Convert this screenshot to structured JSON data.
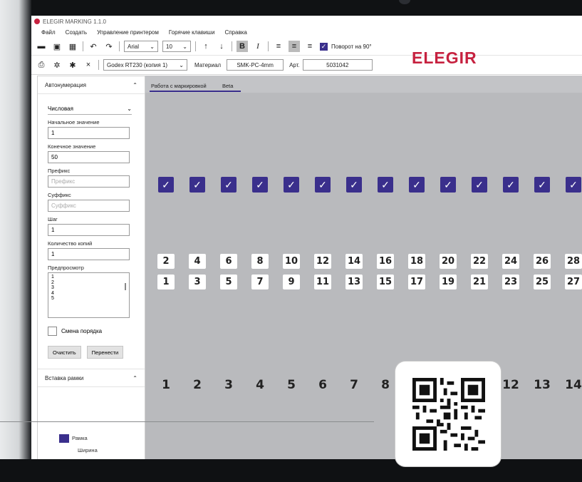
{
  "app": {
    "title": "ELEGIR MARKING 1.1.0"
  },
  "menu": [
    "Файл",
    "Создать",
    "Управление принтером",
    "Горячие клавиши",
    "Справка"
  ],
  "toolbar": {
    "font": "Arial",
    "font_size": "10",
    "rotate_label": "Поворот на 90°",
    "printer": "Godex RT230 (копия 1)",
    "material_label": "Материал",
    "material_value": "SMK-PC-4mm",
    "art_label": "Арт.",
    "art_value": "5031042"
  },
  "brand": "ELEGIR",
  "sidebar": {
    "section1": "Автонумерация",
    "type_value": "Числовая",
    "start_label": "Начальное значение",
    "start_value": "1",
    "end_label": "Конечное значение",
    "end_value": "50",
    "prefix_label": "Префикс",
    "prefix_placeholder": "Префикс",
    "suffix_label": "Суффикс",
    "suffix_placeholder": "Суффикс",
    "step_label": "Шаг",
    "step_value": "1",
    "copies_label": "Количество копий",
    "copies_value": "1",
    "preview_label": "Предпросмотр",
    "preview_lines": [
      "1",
      "2",
      "3",
      "4",
      "5"
    ],
    "swap_label": "Смена порядка",
    "clear_btn": "Очистить",
    "transfer_btn": "Перенести",
    "section2": "Вставка рамки",
    "frame_label": "Рамка",
    "width_label": "Ширина"
  },
  "work": {
    "tab1": "Работа с маркировкой",
    "tab2": "Beta",
    "top_row": [
      "2",
      "4",
      "6",
      "8",
      "10",
      "12",
      "14",
      "16",
      "18",
      "20",
      "22",
      "24",
      "26",
      "28"
    ],
    "bottom_row": [
      "1",
      "3",
      "5",
      "7",
      "9",
      "11",
      "13",
      "15",
      "17",
      "19",
      "21",
      "23",
      "25",
      "27"
    ],
    "col_numbers": [
      "1",
      "2",
      "3",
      "4",
      "5",
      "6",
      "7",
      "8",
      "12",
      "13",
      "14"
    ]
  },
  "colors": {
    "accent": "#3a2f8c",
    "brand": "#c6213f"
  }
}
